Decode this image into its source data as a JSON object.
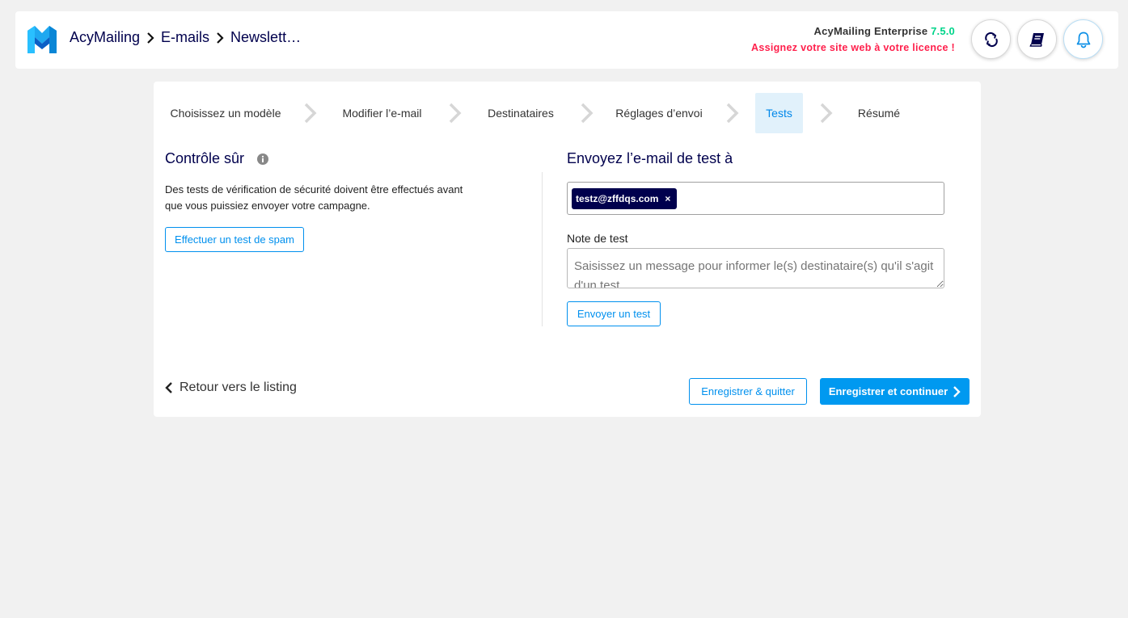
{
  "header": {
    "breadcrumb": [
      "AcyMailing",
      "E-mails",
      "Newslett…"
    ],
    "license_product": "AcyMailing Enterprise",
    "license_version": "7.5.0",
    "license_warning": "Assignez votre site web à votre licence !",
    "buttons": [
      "sync-icon",
      "book-icon",
      "bell-icon"
    ]
  },
  "steps": [
    {
      "label": "Choisissez un modèle",
      "active": false
    },
    {
      "label": "Modifier l’e-mail",
      "active": false
    },
    {
      "label": "Destinataires",
      "active": false
    },
    {
      "label": "Réglages d’envoi",
      "active": false
    },
    {
      "label": "Tests",
      "active": true
    },
    {
      "label": "Résumé",
      "active": false
    }
  ],
  "safe_check": {
    "title": "Contrôle sûr",
    "description": "Des tests de vérification de sécurité doivent être effectués avant que vous puissiez envoyer votre campagne.",
    "spam_button": "Effectuer un test de spam"
  },
  "send_test": {
    "title": "Envoyez l’e-mail de test à",
    "recipients": [
      "testz@zffdqs.com"
    ],
    "remove_symbol": "×",
    "note_label": "Note de test",
    "note_placeholder": "Saisissez un message pour informer le(s) destinataire(s) qu'il s'agit d'un test",
    "send_button": "Envoyer un test"
  },
  "footer": {
    "back_label": "Retour vers le listing",
    "save_quit": "Enregistrer & quitter",
    "save_continue": "Enregistrer et continuer"
  },
  "colors": {
    "accent": "#0099f0",
    "navy": "#00004d",
    "version_green": "#00d48a",
    "warning_red": "#ff1f4b",
    "active_step_bg": "#e1f1fb"
  }
}
